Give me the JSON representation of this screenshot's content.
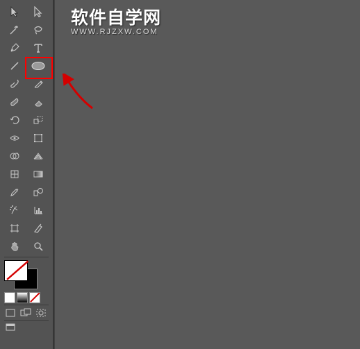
{
  "watermark": {
    "title": "软件自学网",
    "url": "WWW.RJZXW.COM"
  },
  "tools": [
    {
      "name": "selection-tool"
    },
    {
      "name": "direct-selection-tool"
    },
    {
      "name": "magic-wand-tool"
    },
    {
      "name": "lasso-tool"
    },
    {
      "name": "pen-tool"
    },
    {
      "name": "type-tool"
    },
    {
      "name": "line-tool"
    },
    {
      "name": "ellipse-tool"
    },
    {
      "name": "brush-tool"
    },
    {
      "name": "pencil-tool"
    },
    {
      "name": "blob-brush-tool"
    },
    {
      "name": "eraser-tool"
    },
    {
      "name": "rotate-tool"
    },
    {
      "name": "scale-tool"
    },
    {
      "name": "width-tool"
    },
    {
      "name": "free-transform-tool"
    },
    {
      "name": "shape-builder-tool"
    },
    {
      "name": "perspective-grid-tool"
    },
    {
      "name": "mesh-tool"
    },
    {
      "name": "gradient-tool"
    },
    {
      "name": "eyedropper-tool"
    },
    {
      "name": "blend-tool"
    },
    {
      "name": "symbol-sprayer-tool"
    },
    {
      "name": "graph-tool"
    },
    {
      "name": "artboard-tool"
    },
    {
      "name": "slice-tool"
    },
    {
      "name": "hand-tool"
    },
    {
      "name": "zoom-tool"
    }
  ],
  "colors": {
    "fill": "#ffffff",
    "stroke": "#000000",
    "none_indicator": "none"
  },
  "highlighted_tool": "ellipse-tool"
}
